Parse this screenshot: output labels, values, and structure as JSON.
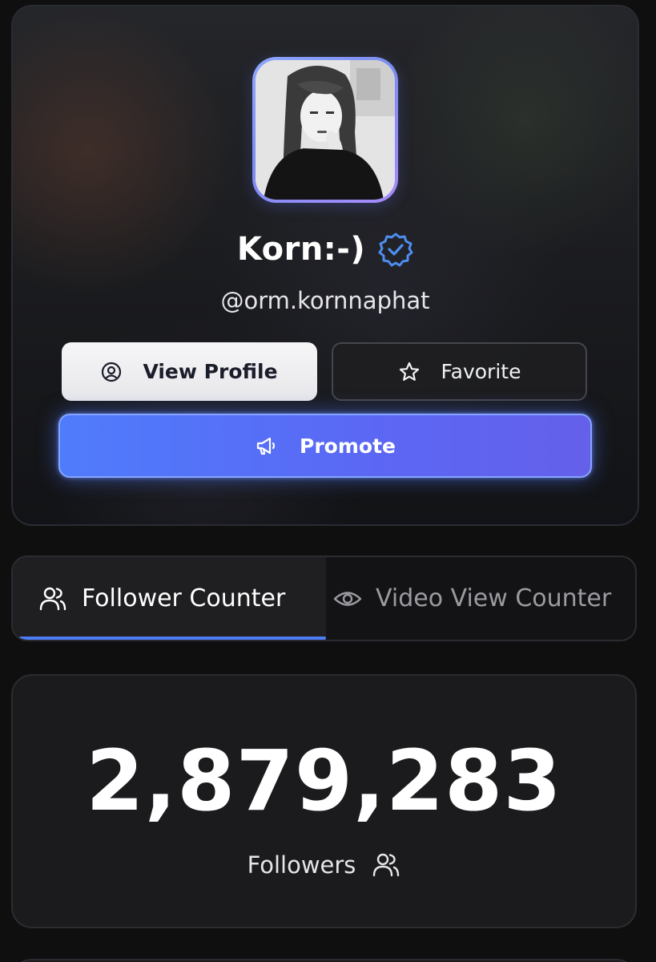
{
  "profile": {
    "name": "Korn:-)",
    "handle": "@orm.kornnaphat",
    "verified": true,
    "avatar_alt": "profile photo",
    "accent_gradient": [
      "#8fa7ff",
      "#a78bfa"
    ]
  },
  "actions": {
    "view_profile_label": "View Profile",
    "favorite_label": "Favorite",
    "promote_label": "Promote",
    "promote_color": "#4f7cfb"
  },
  "tabs": [
    {
      "label": "Follower Counter",
      "icon": "users-icon",
      "active": true
    },
    {
      "label": "Video View Counter",
      "icon": "eye-icon",
      "active": false
    }
  ],
  "counter": {
    "value": "2,879,283",
    "label": "Followers",
    "icon": "users-icon"
  },
  "colors": {
    "background": "#0f0f10",
    "tab_active_underline": "#4d7cf6",
    "verified_badge": "#4d8ef0"
  }
}
